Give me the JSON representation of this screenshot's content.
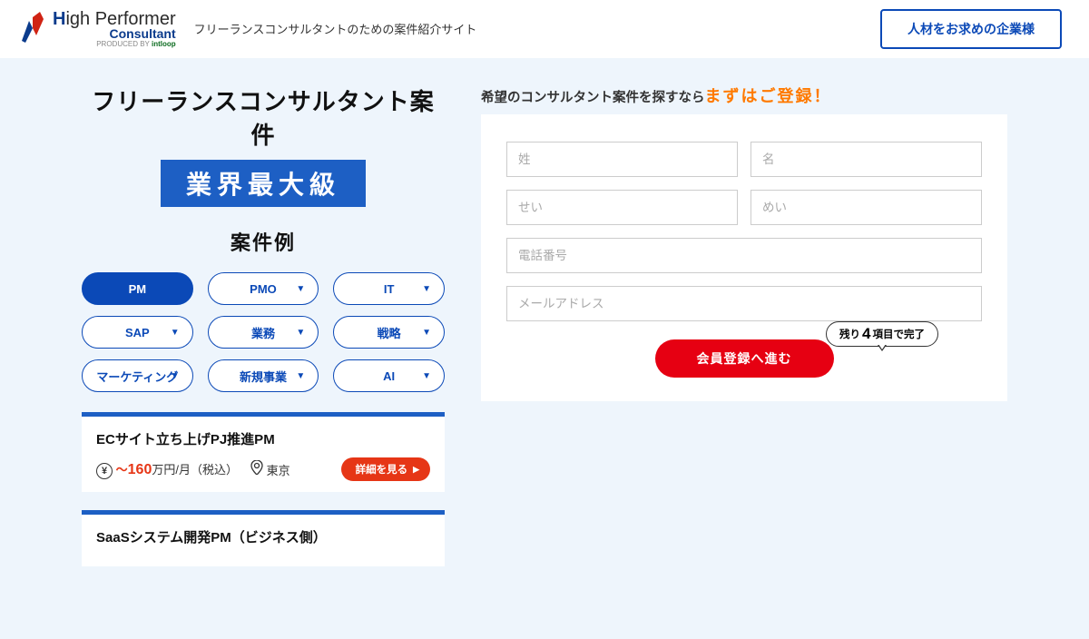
{
  "header": {
    "logo_main_a": "H",
    "logo_main_b": "igh",
    "logo_main_c": " Performer",
    "logo_sub": "Consultant",
    "logo_tag_a": "PRODUCED BY ",
    "logo_tag_b": "intloop",
    "tagline": "フリーランスコンサルタントのための案件紹介サイト",
    "corp_btn": "人材をお求めの企業様"
  },
  "hero": {
    "title": "フリーランスコンサルタント案件",
    "badge": "業界最大級",
    "examples_label": "案件例"
  },
  "categories": [
    {
      "label": "PM",
      "active": true
    },
    {
      "label": "PMO",
      "active": false
    },
    {
      "label": "IT",
      "active": false
    },
    {
      "label": "SAP",
      "active": false
    },
    {
      "label": "業務",
      "active": false
    },
    {
      "label": "戦略",
      "active": false
    },
    {
      "label": "マーケティング",
      "active": false
    },
    {
      "label": "新規事業",
      "active": false
    },
    {
      "label": "AI",
      "active": false
    }
  ],
  "jobs": [
    {
      "title": "ECサイト立ち上げPJ推進PM",
      "salary_wave": "〜",
      "salary_num": "160",
      "salary_unit": "万円/月（税込）",
      "location": "東京",
      "detail": "詳細を見る"
    },
    {
      "title": "SaaSシステム開発PM（ビジネス側）"
    }
  ],
  "register": {
    "lead_a": "希望のコンサルタント案件を探すなら",
    "lead_b": "まずはご登録！",
    "ph_lastname": "姓",
    "ph_firstname": "名",
    "ph_lastkana": "せい",
    "ph_firstkana": "めい",
    "ph_phone": "電話番号",
    "ph_email": "メールアドレス",
    "bubble_a": "残り ",
    "bubble_num": "4",
    "bubble_b": " 項目で完了",
    "submit": "会員登録へ進む"
  }
}
